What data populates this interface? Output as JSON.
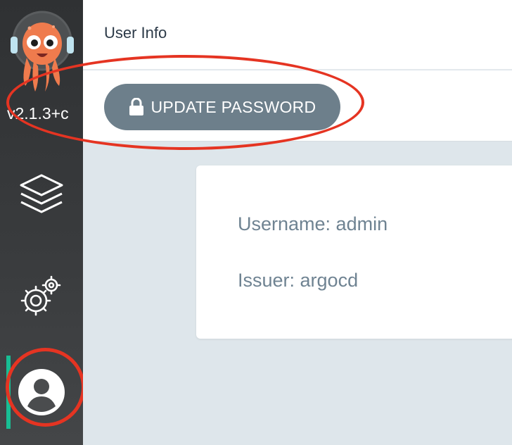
{
  "sidebar": {
    "version": "v2.1.3+c",
    "items": [
      {
        "label": "Applications",
        "icon": "layers-icon"
      },
      {
        "label": "Settings",
        "icon": "gears-icon"
      },
      {
        "label": "User Info",
        "icon": "user-icon",
        "active": true
      }
    ],
    "logo": "argo-octopus-logo"
  },
  "header": {
    "title": "User Info"
  },
  "toolbar": {
    "update_password_label": "UPDATE PASSWORD",
    "update_password_icon": "lock-icon"
  },
  "user": {
    "username_line": "Username: admin",
    "issuer_line": "Issuer: argocd"
  },
  "colors": {
    "sidebar_bg": "#333537",
    "accent": "#18be94",
    "button_bg": "#6d7f8b",
    "annotation": "#e53422",
    "page_bg": "#dee6eb"
  }
}
